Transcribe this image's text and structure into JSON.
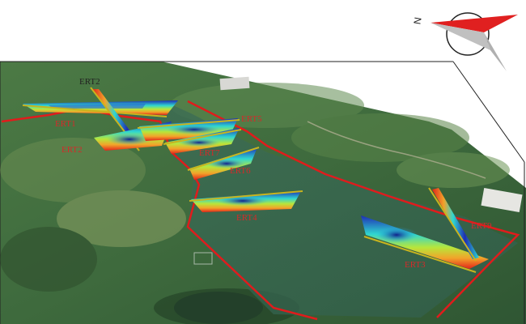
{
  "compass": {
    "letter": "N",
    "icon": "north-arrow-icon"
  },
  "colors": {
    "boundary": "#e01c1c",
    "label": "#d42a2a",
    "label_dark": "#222222",
    "terrain_base": "#3f6a3c",
    "lake": "#3b6b56",
    "resistivity_low": "#1e2db5",
    "resistivity_mid": "#2fd6d0",
    "resistivity_high": "#e2231a"
  },
  "profiles": [
    {
      "id": "ERT2",
      "label": "ERT2"
    },
    {
      "id": "ERT1",
      "label": "ERT1"
    },
    {
      "id": "ERT2b",
      "label": "ERT2"
    },
    {
      "id": "ERT5",
      "label": "ERT5"
    },
    {
      "id": "ERT7",
      "label": "ERT7"
    },
    {
      "id": "ERT6",
      "label": "ERT6"
    },
    {
      "id": "ERT4",
      "label": "ERT4"
    },
    {
      "id": "ERT3",
      "label": "ERT3"
    },
    {
      "id": "ERT9",
      "label": "ERT9"
    }
  ]
}
